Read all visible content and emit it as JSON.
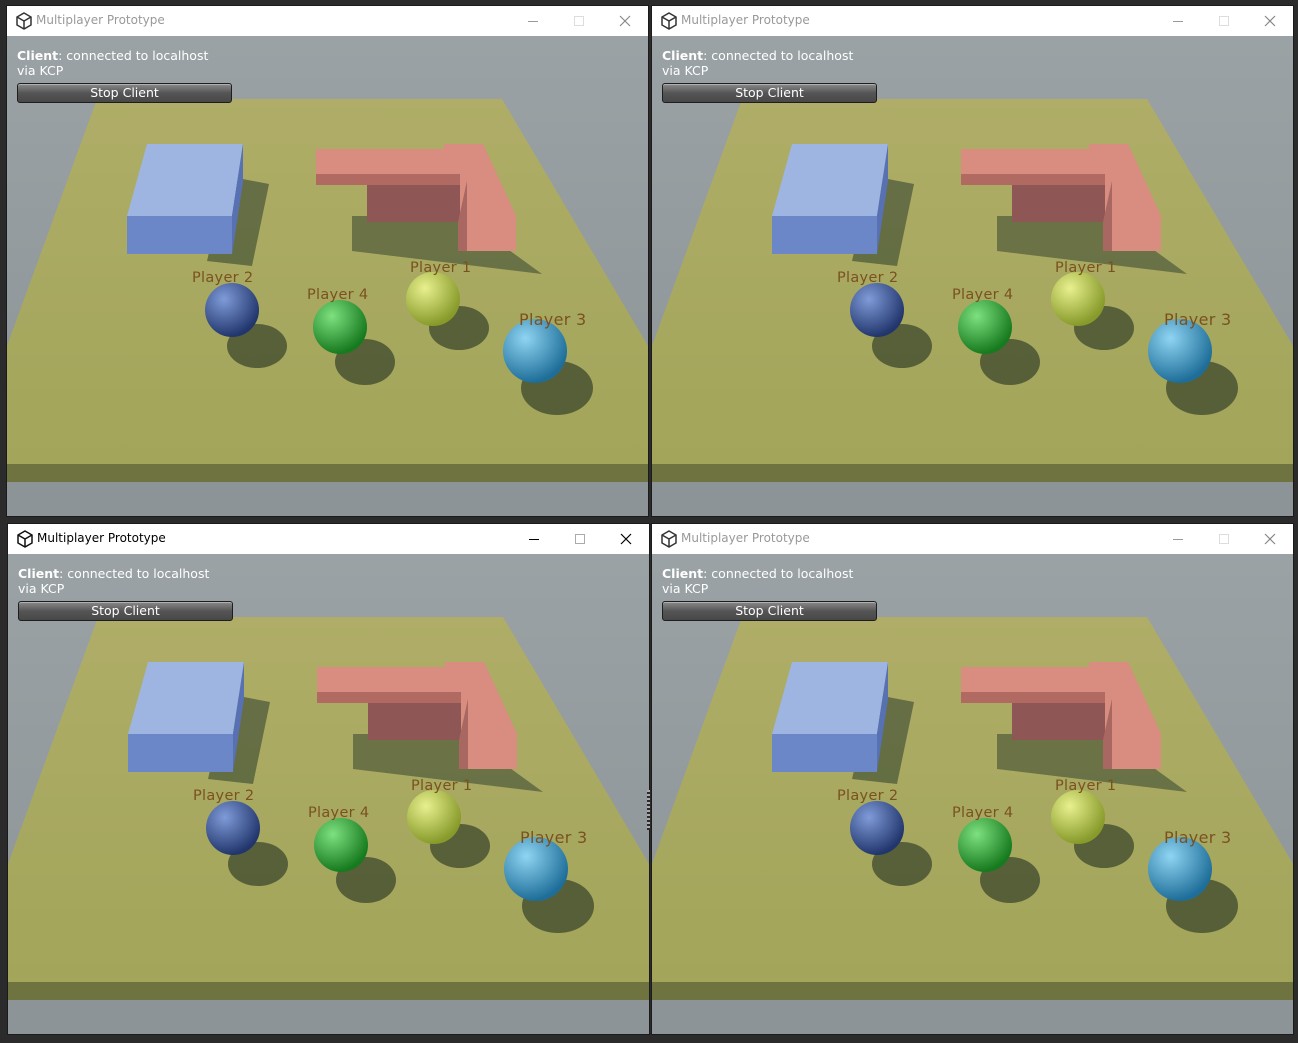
{
  "windows": [
    {
      "title": "Multiplayer Prototype",
      "active": false,
      "status_prefix": "Client",
      "status_text": ": connected to localhost via KCP",
      "button_label": "Stop Client",
      "players": [
        "Player 1",
        "Player 2",
        "Player 3",
        "Player 4"
      ]
    },
    {
      "title": "Multiplayer Prototype",
      "active": false,
      "status_prefix": "Client",
      "status_text": ": connected to localhost via KCP",
      "button_label": "Stop Client",
      "players": [
        "Player 1",
        "Player 2",
        "Player 3",
        "Player 4"
      ]
    },
    {
      "title": "Multiplayer Prototype",
      "active": true,
      "status_prefix": "Client",
      "status_text": ": connected to localhost via KCP",
      "button_label": "Stop Client",
      "players": [
        "Player 1",
        "Player 2",
        "Player 3",
        "Player 4"
      ]
    },
    {
      "title": "Multiplayer Prototype",
      "active": false,
      "status_prefix": "Client",
      "status_text": ": connected to localhost via KCP",
      "button_label": "Stop Client",
      "players": [
        "Player 1",
        "Player 2",
        "Player 3",
        "Player 4"
      ]
    }
  ],
  "colors": {
    "ground": "#a9aa5c",
    "blue_box": "#8aa6d6",
    "red_block": "#d88a7c",
    "player1_sphere": "#c3d15a",
    "player2_sphere": "#3a5a9e",
    "player3_sphere": "#4aa3d0",
    "player4_sphere": "#2eaa3a",
    "label_text": "#7a5220"
  },
  "icons": {
    "app": "unity-logo-icon",
    "minimize": "minimize-icon",
    "maximize": "maximize-icon",
    "close": "close-icon"
  }
}
